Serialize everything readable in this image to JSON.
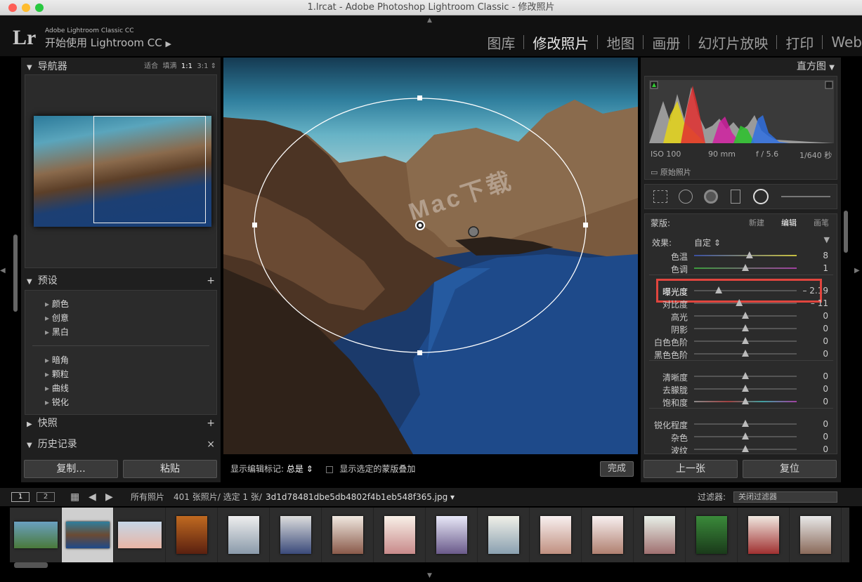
{
  "window": {
    "title": "1.lrcat - Adobe Photoshop Lightroom Classic - 修改照片"
  },
  "identity": {
    "logo": "Lr",
    "product_small": "Adobe Lightroom Classic CC",
    "product_main": "开始使用 Lightroom CC"
  },
  "modules": [
    {
      "label": "图库"
    },
    {
      "label": "修改照片",
      "active": true
    },
    {
      "label": "地图"
    },
    {
      "label": "画册"
    },
    {
      "label": "幻灯片放映"
    },
    {
      "label": "打印"
    },
    {
      "label": "Web"
    }
  ],
  "left": {
    "navigator": {
      "title": "导航器",
      "zoom": [
        "适合",
        "填满",
        "1:1",
        "3:1"
      ]
    },
    "presets": {
      "title": "预设",
      "group1": [
        "颜色",
        "创意",
        "黑白"
      ],
      "group2": [
        "暗角",
        "颗粒",
        "曲线",
        "锐化"
      ]
    },
    "snapshots": {
      "title": "快照"
    },
    "history": {
      "title": "历史记录"
    },
    "copy_label": "复制...",
    "paste_label": "粘贴"
  },
  "toolbar": {
    "show_edit_pins": "显示编辑标记:",
    "pins_value": "总是",
    "overlay_label": "显示选定的蒙版叠加",
    "done_label": "完成"
  },
  "right": {
    "histogram": {
      "title": "直方图",
      "iso": "ISO 100",
      "focal": "90 mm",
      "aperture": "f / 5.6",
      "shutter": "1/640 秒",
      "original_label": "原始照片"
    },
    "mask": {
      "title": "蒙版:",
      "new": "新建",
      "edit": "编辑",
      "brush": "画笔",
      "effect_label": "效果:",
      "effect_value": "自定",
      "sliders": [
        {
          "label": "色温",
          "value": "8",
          "pos": 0.54
        },
        {
          "label": "色调",
          "value": "1",
          "pos": 0.5
        },
        {
          "label": "曝光度",
          "value": "– 2.19",
          "pos": 0.24,
          "highlight": true
        },
        {
          "label": "对比度",
          "value": "– 11",
          "pos": 0.44
        },
        {
          "label": "高光",
          "value": "0",
          "pos": 0.5
        },
        {
          "label": "阴影",
          "value": "0",
          "pos": 0.5
        },
        {
          "label": "白色色阶",
          "value": "0",
          "pos": 0.5
        },
        {
          "label": "黑色色阶",
          "value": "0",
          "pos": 0.5
        },
        {
          "label": "清晰度",
          "value": "0",
          "pos": 0.5
        },
        {
          "label": "去朦胧",
          "value": "0",
          "pos": 0.5
        },
        {
          "label": "饱和度",
          "value": "0",
          "pos": 0.5
        },
        {
          "label": "锐化程度",
          "value": "0",
          "pos": 0.5
        },
        {
          "label": "杂色",
          "value": "0",
          "pos": 0.5
        },
        {
          "label": "波纹",
          "value": "0",
          "pos": 0.5
        }
      ]
    },
    "prev_label": "上一张",
    "reset_label": "复位"
  },
  "filmstrip": {
    "view1": "1",
    "view2": "2",
    "source": "所有照片",
    "count": "401 张照片/ 选定 1 张/",
    "filename": "3d1d78481dbe5db4802f4b1eb548f365.jpg ▾",
    "filter_label": "过滤器:",
    "filter_value": "关闭过滤器"
  },
  "watermark": "Mac下载"
}
